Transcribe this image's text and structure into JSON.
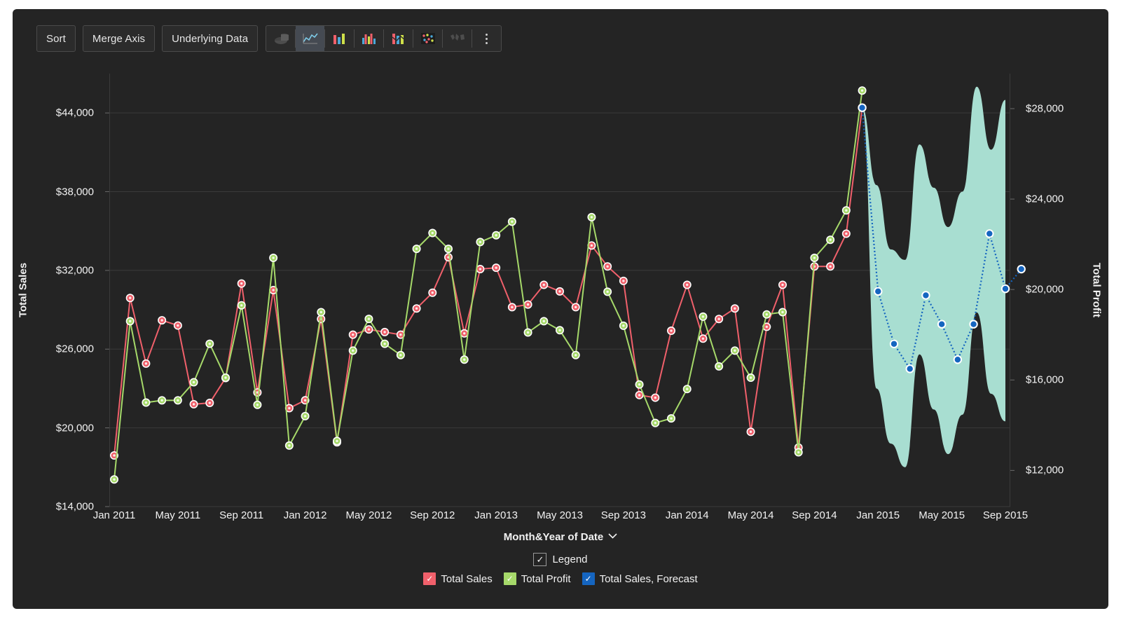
{
  "toolbar": {
    "buttons": [
      {
        "name": "sort-button",
        "label": "Sort"
      },
      {
        "name": "merge-axis-button",
        "label": "Merge Axis"
      },
      {
        "name": "underlying-data-button",
        "label": "Underlying Data"
      }
    ],
    "viz_types": [
      {
        "name": "pie-chart-icon",
        "label": "Pie Chart",
        "active": false
      },
      {
        "name": "line-chart-icon",
        "label": "Line Chart",
        "active": true
      },
      {
        "name": "bar-chart-icon",
        "label": "Bar Chart",
        "active": false
      },
      {
        "name": "grouped-bar-chart-icon",
        "label": "Grouped Bar Chart",
        "active": false
      },
      {
        "name": "combo-chart-icon",
        "label": "Combo Chart",
        "active": false
      },
      {
        "name": "scatter-plot-icon",
        "label": "Scatter Plot",
        "active": false
      },
      {
        "name": "map-chart-icon",
        "label": "Map",
        "active": false
      }
    ],
    "more_label": "More options"
  },
  "legend": {
    "title": "Legend",
    "checked": true,
    "check_glyph": "✓",
    "items": [
      {
        "label": "Total Sales",
        "color": "#f0606b",
        "checked": true
      },
      {
        "label": "Total Profit",
        "color": "#a6d96a",
        "checked": true
      },
      {
        "label": "Total Sales, Forecast",
        "color": "#1565c0",
        "checked": true
      }
    ]
  },
  "chart_data": {
    "type": "line",
    "title": "",
    "xlabel": "Month&Year of Date",
    "xlabel_chevron": "⌄",
    "ylabel": "Total Sales",
    "ylabel_right": "Total Profit",
    "ylim": [
      14000,
      47000
    ],
    "ylim_right": [
      10400,
      29550
    ],
    "yticks": [
      14000,
      20000,
      26000,
      32000,
      38000,
      44000
    ],
    "ytick_labels": [
      "$14,000",
      "$20,000",
      "$26,000",
      "$32,000",
      "$38,000",
      "$44,000"
    ],
    "yticks_right": [
      12000,
      16000,
      20000,
      24000,
      28000
    ],
    "ytick_labels_right": [
      "$12,000",
      "$16,000",
      "$20,000",
      "$24,000",
      "$28,000"
    ],
    "grid": true,
    "legend_position": "bottom",
    "xticks": [
      "Jan 2011",
      "May 2011",
      "Sep 2011",
      "Jan 2012",
      "May 2012",
      "Sep 2012",
      "Jan 2013",
      "May 2013",
      "Sep 2013",
      "Jan 2014",
      "May 2014",
      "Sep 2014",
      "Jan 2015",
      "May 2015",
      "Sep 2015"
    ],
    "xtick_index": [
      0,
      4,
      8,
      12,
      16,
      20,
      24,
      28,
      32,
      36,
      40,
      44,
      48,
      52,
      56
    ],
    "x": [
      "Jan 2011",
      "Feb 2011",
      "Mar 2011",
      "Apr 2011",
      "May 2011",
      "Jun 2011",
      "Jul 2011",
      "Aug 2011",
      "Sep 2011",
      "Oct 2011",
      "Nov 2011",
      "Dec 2011",
      "Jan 2012",
      "Feb 2012",
      "Mar 2012",
      "Apr 2012",
      "May 2012",
      "Jun 2012",
      "Jul 2012",
      "Aug 2012",
      "Sep 2012",
      "Oct 2012",
      "Nov 2012",
      "Dec 2012",
      "Jan 2013",
      "Feb 2013",
      "Mar 2013",
      "Apr 2013",
      "May 2013",
      "Jun 2013",
      "Jul 2013",
      "Aug 2013",
      "Sep 2013",
      "Oct 2013",
      "Nov 2013",
      "Dec 2013",
      "Jan 2014",
      "Feb 2014",
      "Mar 2014",
      "Apr 2014",
      "May 2014",
      "Jun 2014",
      "Jul 2014",
      "Aug 2014",
      "Sep 2014",
      "Oct 2014",
      "Nov 2014",
      "Dec 2014",
      "Jan 2015",
      "Feb 2015",
      "Mar 2015",
      "Apr 2015",
      "May 2015",
      "Jun 2015",
      "Jul 2015",
      "Aug 2015",
      "Sep 2015"
    ],
    "series": [
      {
        "name": "Total Sales",
        "color": "#f0606b",
        "axis": "left",
        "values": [
          17900,
          29900,
          24900,
          28200,
          27800,
          21800,
          21900,
          23800,
          31000,
          22700,
          30500,
          21500,
          22100,
          28300,
          18900,
          27100,
          27500,
          27300,
          27100,
          29100,
          30300,
          33000,
          27200,
          32100,
          32200,
          29200,
          29400,
          30900,
          30400,
          29200,
          33900,
          32300,
          31200,
          22500,
          22300,
          27400,
          30900,
          26800,
          28300,
          29100,
          19700,
          27700,
          30900,
          18500,
          32300,
          32300,
          34800,
          44400,
          null,
          null,
          null,
          null,
          null,
          null,
          null,
          null,
          null
        ],
        "marker": "circle-open"
      },
      {
        "name": "Total Profit",
        "color": "#a6d96a",
        "axis": "right",
        "values": [
          11600,
          18600,
          15000,
          15100,
          15100,
          15900,
          17600,
          16100,
          19300,
          14900,
          21400,
          13100,
          14400,
          19000,
          13300,
          17300,
          18700,
          17600,
          17100,
          21800,
          22500,
          21800,
          16900,
          22100,
          22400,
          23000,
          18100,
          18600,
          18200,
          17100,
          23200,
          19900,
          18400,
          15800,
          14100,
          14300,
          15600,
          18800,
          16600,
          17300,
          16100,
          18900,
          19000,
          12800,
          21400,
          22200,
          23500,
          28800,
          null,
          null,
          null,
          null,
          null,
          null,
          null,
          null,
          null
        ],
        "marker": "circle-open"
      },
      {
        "name": "Total Sales, Forecast",
        "color": "#1565c0",
        "axis": "left",
        "style": "dotted",
        "values": [
          null,
          null,
          null,
          null,
          null,
          null,
          null,
          null,
          null,
          null,
          null,
          null,
          null,
          null,
          null,
          null,
          null,
          null,
          null,
          null,
          null,
          null,
          null,
          null,
          null,
          null,
          null,
          null,
          null,
          null,
          null,
          null,
          null,
          null,
          null,
          null,
          null,
          null,
          null,
          null,
          null,
          null,
          null,
          null,
          null,
          null,
          null,
          44400,
          30400,
          26400,
          24500,
          30100,
          27900,
          25200,
          27900,
          34800,
          30600,
          32100
        ],
        "marker": "circle-filled"
      }
    ],
    "forecast_band": {
      "name": "Forecast confidence interval",
      "color": "#a8ded1",
      "opacity": 1,
      "upper": [
        44400,
        38500,
        33600,
        32800,
        41600,
        38300,
        35300,
        38000,
        46000,
        41200,
        45000
      ],
      "lower": [
        44400,
        23000,
        18800,
        17000,
        25600,
        21400,
        18000,
        21000,
        28800,
        22600,
        20500
      ]
    }
  }
}
